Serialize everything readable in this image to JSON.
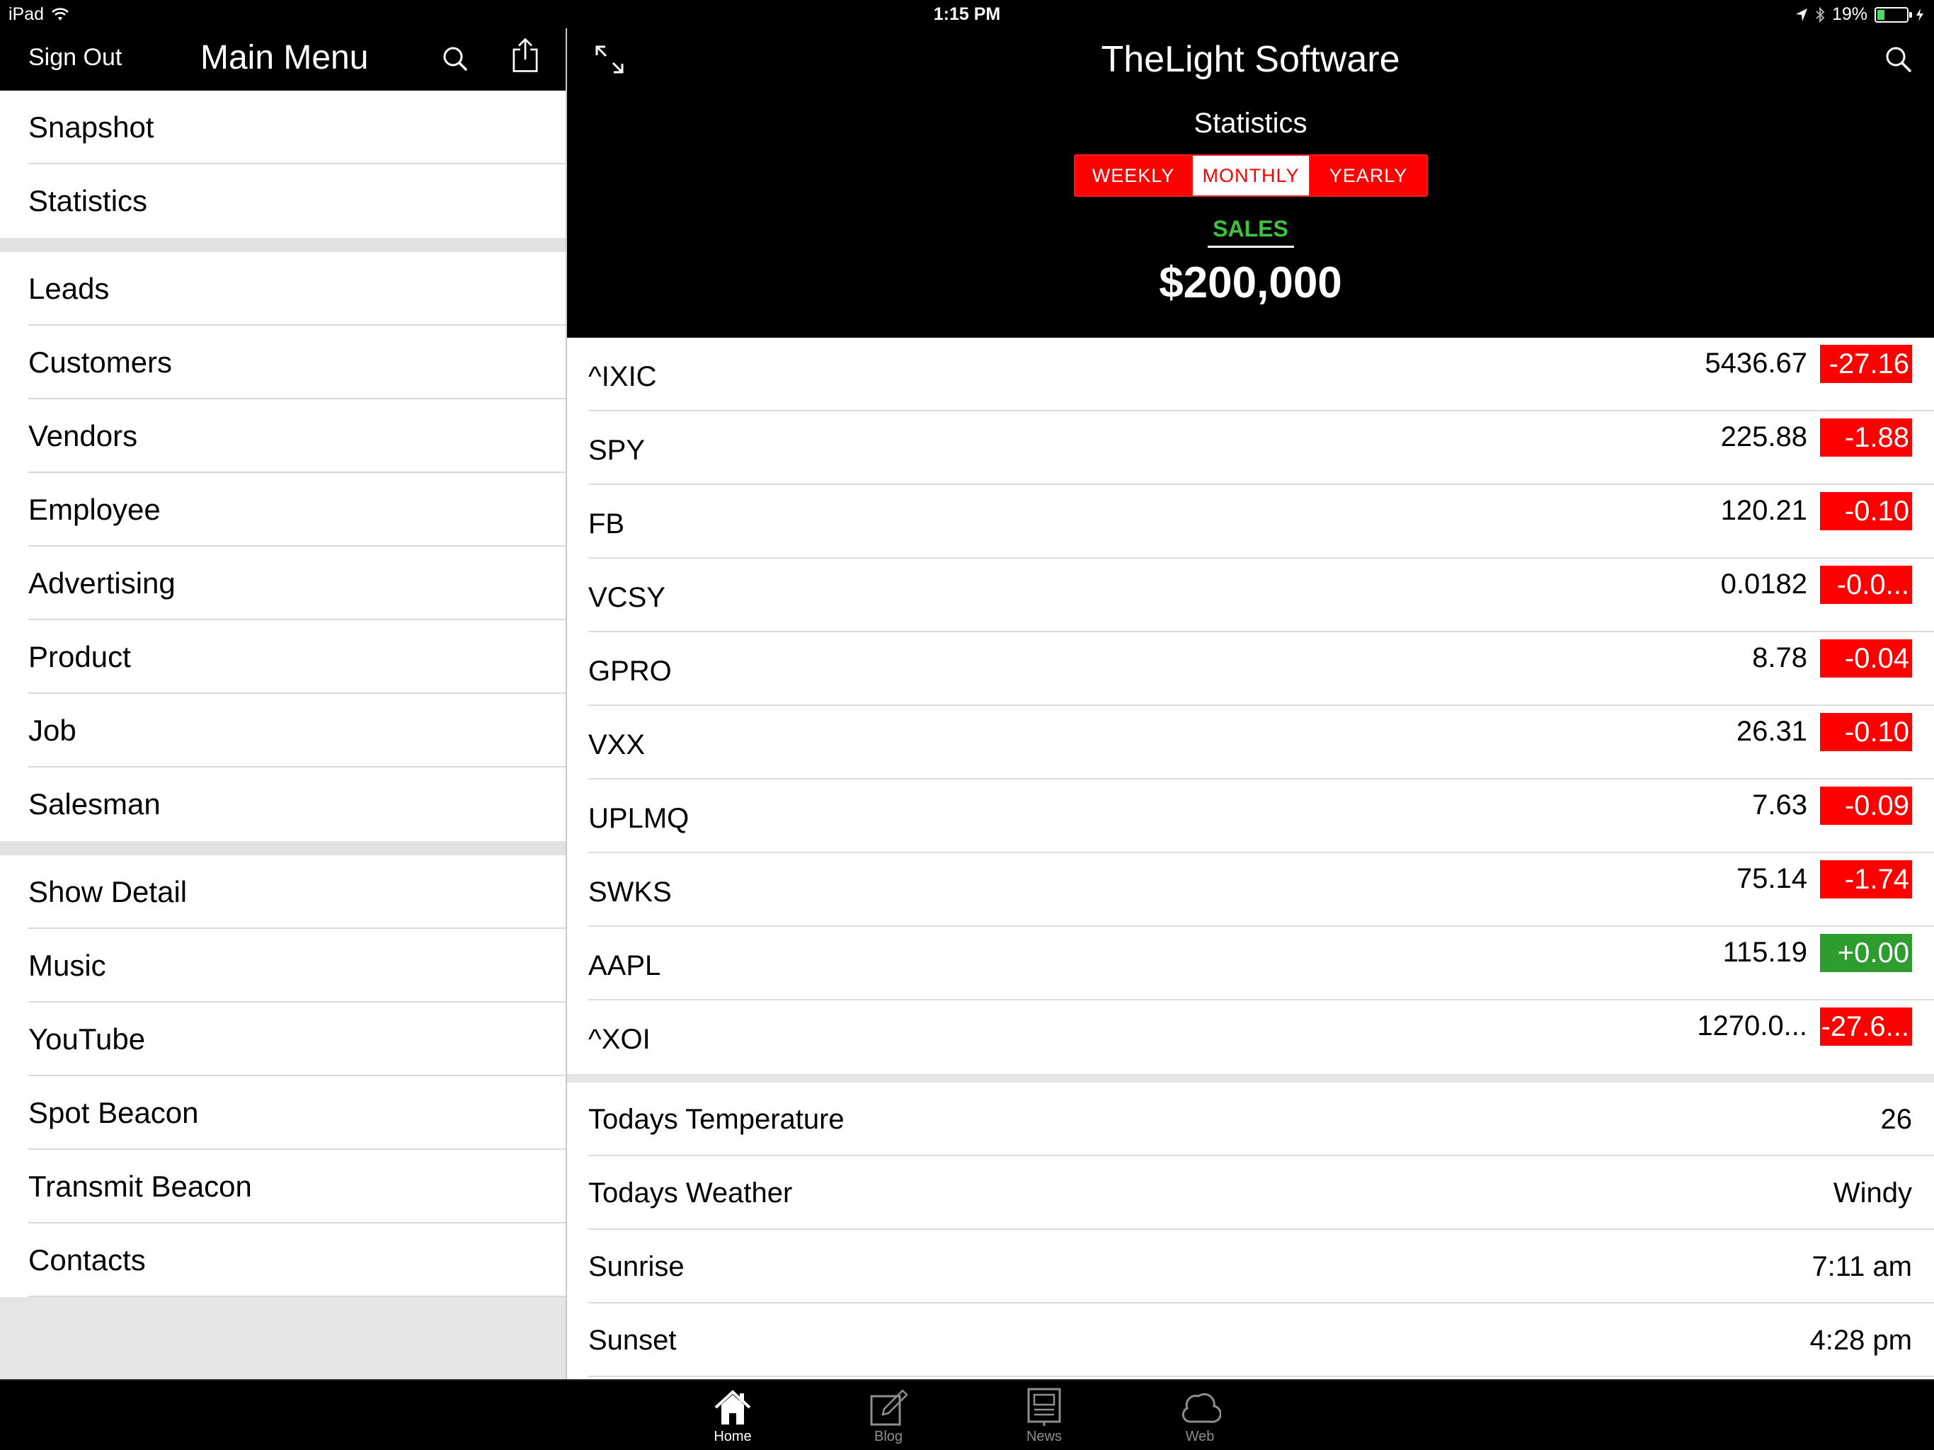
{
  "status_bar": {
    "device": "iPad",
    "time": "1:15 PM",
    "battery": "19%",
    "battery_level": 0.19
  },
  "sidebar": {
    "sign_out": "Sign Out",
    "title": "Main Menu",
    "groups": [
      [
        "Snapshot",
        "Statistics"
      ],
      [
        "Leads",
        "Customers",
        "Vendors",
        "Employee",
        "Advertising",
        "Product",
        "Job",
        "Salesman"
      ],
      [
        "Show Detail",
        "Music",
        "YouTube",
        "Spot Beacon",
        "Transmit Beacon",
        "Contacts"
      ]
    ]
  },
  "main": {
    "app_title": "TheLight Software",
    "section_title": "Statistics",
    "segments": [
      {
        "label": "WEEKLY",
        "selected": false
      },
      {
        "label": "MONTHLY",
        "selected": true
      },
      {
        "label": "YEARLY",
        "selected": false
      }
    ],
    "sales_label": "SALES",
    "sales_value": "$200,000",
    "quotes": [
      {
        "symbol": "^IXIC",
        "price": "5436.67",
        "change": "-27.16",
        "direction": "down"
      },
      {
        "symbol": "SPY",
        "price": "225.88",
        "change": "-1.88",
        "direction": "down"
      },
      {
        "symbol": "FB",
        "price": "120.21",
        "change": "-0.10",
        "direction": "down"
      },
      {
        "symbol": "VCSY",
        "price": "0.0182",
        "change": "-0.0...",
        "direction": "down"
      },
      {
        "symbol": "GPRO",
        "price": "8.78",
        "change": "-0.04",
        "direction": "down"
      },
      {
        "symbol": "VXX",
        "price": "26.31",
        "change": "-0.10",
        "direction": "down"
      },
      {
        "symbol": "UPLMQ",
        "price": "7.63",
        "change": "-0.09",
        "direction": "down"
      },
      {
        "symbol": "SWKS",
        "price": "75.14",
        "change": "-1.74",
        "direction": "down"
      },
      {
        "symbol": "AAPL",
        "price": "115.19",
        "change": "+0.00",
        "direction": "up"
      },
      {
        "symbol": "^XOI",
        "price": "1270.0...",
        "change": "-27.6...",
        "direction": "down"
      }
    ],
    "info": [
      {
        "label": "Todays Temperature",
        "value": "26"
      },
      {
        "label": "Todays Weather",
        "value": "Windy"
      },
      {
        "label": "Sunrise",
        "value": "7:11 am"
      },
      {
        "label": "Sunset",
        "value": "4:28 pm"
      }
    ]
  },
  "tab_bar": [
    {
      "label": "Home",
      "icon": "home-icon",
      "active": true
    },
    {
      "label": "Blog",
      "icon": "compose-icon",
      "active": false
    },
    {
      "label": "News",
      "icon": "newspaper-icon",
      "active": false
    },
    {
      "label": "Web",
      "icon": "cloud-icon",
      "active": false
    }
  ],
  "colors": {
    "negative": "#ff0000",
    "positive": "#2e9c2e",
    "sales_label": "#3ec23e",
    "accent": "#ff0000"
  }
}
